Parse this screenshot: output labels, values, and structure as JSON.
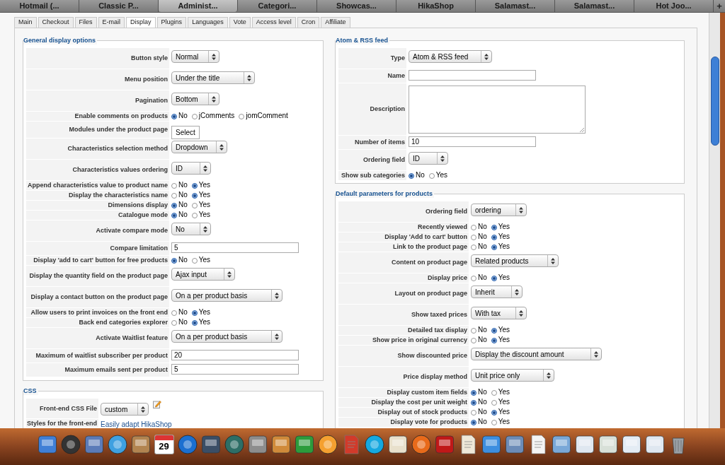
{
  "browser_tabs": [
    {
      "label": "Hotmail (...",
      "selected": false
    },
    {
      "label": "Classic P...",
      "selected": false
    },
    {
      "label": "Administ...",
      "selected": true
    },
    {
      "label": "Categori...",
      "selected": false
    },
    {
      "label": "Showcas...",
      "selected": false
    },
    {
      "label": "HikaShop",
      "selected": false
    },
    {
      "label": "Salamast...",
      "selected": false
    },
    {
      "label": "Salamast...",
      "selected": false
    },
    {
      "label": "Hot Joo...",
      "selected": false
    }
  ],
  "new_tab": "+",
  "page_tabs": [
    {
      "label": "Main",
      "selected": false
    },
    {
      "label": "Checkout",
      "selected": false
    },
    {
      "label": "Files",
      "selected": false
    },
    {
      "label": "E-mail",
      "selected": false
    },
    {
      "label": "Display",
      "selected": true
    },
    {
      "label": "Plugins",
      "selected": false
    },
    {
      "label": "Languages",
      "selected": false
    },
    {
      "label": "Vote",
      "selected": false
    },
    {
      "label": "Access level",
      "selected": false
    },
    {
      "label": "Cron",
      "selected": false
    },
    {
      "label": "Affiliate",
      "selected": false
    }
  ],
  "general": {
    "legend": "General display options",
    "rows": [
      {
        "kind": "select",
        "label": "Button style",
        "value": "Normal"
      },
      {
        "kind": "select",
        "label": "Menu position",
        "value": "Under the title"
      },
      {
        "kind": "select",
        "label": "Pagination",
        "value": "Bottom"
      },
      {
        "kind": "radio",
        "label": "Enable comments on products",
        "options": [
          {
            "label": "No",
            "selected": true
          },
          {
            "label": "jComments",
            "selected": false
          },
          {
            "label": "jomComment",
            "selected": false
          }
        ]
      },
      {
        "kind": "button",
        "label": "Modules under the product page",
        "value": "Select"
      },
      {
        "kind": "select",
        "label": "Characteristics selection method",
        "value": "Dropdown"
      },
      {
        "kind": "select",
        "label": "Characteristics values ordering",
        "value": "ID"
      },
      {
        "kind": "radio",
        "label": "Append characteristics value to product name",
        "options": [
          {
            "label": "No",
            "selected": false
          },
          {
            "label": "Yes",
            "selected": true
          }
        ]
      },
      {
        "kind": "radio",
        "label": "Display the characteristics name",
        "options": [
          {
            "label": "No",
            "selected": false
          },
          {
            "label": "Yes",
            "selected": true
          }
        ]
      },
      {
        "kind": "radio",
        "label": "Dimensions display",
        "options": [
          {
            "label": "No",
            "selected": true
          },
          {
            "label": "Yes",
            "selected": false
          }
        ]
      },
      {
        "kind": "radio",
        "label": "Catalogue mode",
        "options": [
          {
            "label": "No",
            "selected": true
          },
          {
            "label": "Yes",
            "selected": false
          }
        ]
      },
      {
        "kind": "select",
        "label": "Activate compare mode",
        "value": "No"
      },
      {
        "kind": "input",
        "label": "Compare limitation",
        "value": "5"
      },
      {
        "kind": "radio",
        "label": "Display 'add to cart' button for free products",
        "options": [
          {
            "label": "No",
            "selected": true
          },
          {
            "label": "Yes",
            "selected": false
          }
        ]
      },
      {
        "kind": "select",
        "label": "Display the quantity field on the product page",
        "value": "Ajax input"
      },
      {
        "kind": "select",
        "label": "Display a contact button on the product page",
        "value": "On a per product basis"
      },
      {
        "kind": "radio",
        "label": "Allow users to print invoices on the front end",
        "options": [
          {
            "label": "No",
            "selected": false
          },
          {
            "label": "Yes",
            "selected": true
          }
        ]
      },
      {
        "kind": "radio",
        "label": "Back end categories explorer",
        "options": [
          {
            "label": "No",
            "selected": false
          },
          {
            "label": "Yes",
            "selected": true
          }
        ]
      },
      {
        "kind": "select",
        "label": "Activate Waitlist feature",
        "value": "On a per product basis"
      },
      {
        "kind": "input",
        "label": "Maximum of waitlist subscriber per product",
        "value": "20"
      },
      {
        "kind": "input",
        "label": "Maximum emails sent per product",
        "value": "5"
      }
    ]
  },
  "css": {
    "legend": "CSS",
    "rows": [
      {
        "kind": "select_edit",
        "label": "Front-end CSS File",
        "value": "custom"
      },
      {
        "kind": "link",
        "label": "Styles for the front-end",
        "value": "Easily adapt HikaShop"
      }
    ]
  },
  "atom_feed": {
    "legend": "Atom & RSS feed",
    "rows": [
      {
        "kind": "select",
        "label": "Type",
        "value": "Atom & RSS feed"
      },
      {
        "kind": "input",
        "label": "Name",
        "value": ""
      },
      {
        "kind": "textarea",
        "label": "Description",
        "value": ""
      },
      {
        "kind": "input",
        "label": "Number of items",
        "value": "10"
      },
      {
        "kind": "select",
        "label": "Ordering field",
        "value": "ID"
      },
      {
        "kind": "radio",
        "label": "Show sub categories",
        "options": [
          {
            "label": "No",
            "selected": true
          },
          {
            "label": "Yes",
            "selected": false
          }
        ]
      }
    ]
  },
  "product_defaults": {
    "legend": "Default parameters for products",
    "rows": [
      {
        "kind": "select",
        "label": "Ordering field",
        "value": "ordering"
      },
      {
        "kind": "radio",
        "label": "Recently viewed",
        "options": [
          {
            "label": "No",
            "selected": false
          },
          {
            "label": "Yes",
            "selected": true
          }
        ]
      },
      {
        "kind": "radio",
        "label": "Display 'Add to cart' button",
        "options": [
          {
            "label": "No",
            "selected": false
          },
          {
            "label": "Yes",
            "selected": true
          }
        ]
      },
      {
        "kind": "radio",
        "label": "Link to the product page",
        "options": [
          {
            "label": "No",
            "selected": false
          },
          {
            "label": "Yes",
            "selected": true
          }
        ]
      },
      {
        "kind": "select",
        "label": "Content on product page",
        "value": "Related products"
      },
      {
        "kind": "radio",
        "label": "Display price",
        "options": [
          {
            "label": "No",
            "selected": false
          },
          {
            "label": "Yes",
            "selected": true
          }
        ]
      },
      {
        "kind": "select",
        "label": "Layout on product page",
        "value": "Inherit"
      },
      {
        "kind": "select",
        "label": "Show taxed prices",
        "value": "With tax"
      },
      {
        "kind": "radio",
        "label": "Detailed tax display",
        "options": [
          {
            "label": "No",
            "selected": false
          },
          {
            "label": "Yes",
            "selected": true
          }
        ]
      },
      {
        "kind": "radio",
        "label": "Show price in original currency",
        "options": [
          {
            "label": "No",
            "selected": false
          },
          {
            "label": "Yes",
            "selected": true
          }
        ]
      },
      {
        "kind": "select",
        "label": "Show discounted price",
        "value": "Display the discount amount"
      },
      {
        "kind": "select",
        "label": "Price display method",
        "value": "Unit price only"
      },
      {
        "kind": "radio",
        "label": "Display custom item fields",
        "options": [
          {
            "label": "No",
            "selected": true
          },
          {
            "label": "Yes",
            "selected": false
          }
        ]
      },
      {
        "kind": "radio",
        "label": "Display the cost per unit weight",
        "options": [
          {
            "label": "No",
            "selected": true
          },
          {
            "label": "Yes",
            "selected": false
          }
        ]
      },
      {
        "kind": "radio",
        "label": "Display out of stock products",
        "options": [
          {
            "label": "No",
            "selected": false
          },
          {
            "label": "Yes",
            "selected": true
          }
        ]
      },
      {
        "kind": "radio",
        "label": "Display vote for products",
        "options": [
          {
            "label": "No",
            "selected": true
          },
          {
            "label": "Yes",
            "selected": false
          }
        ]
      }
    ]
  },
  "dock": {
    "calendar_day": "29"
  }
}
